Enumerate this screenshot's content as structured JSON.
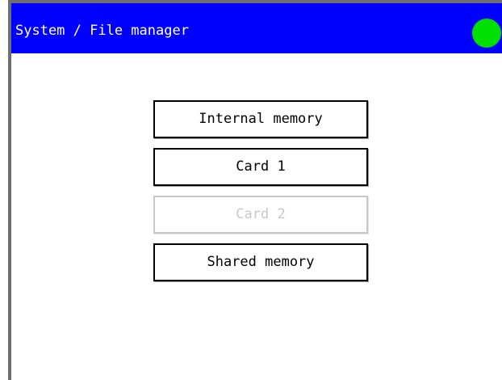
{
  "header": {
    "title": "System / File manager",
    "status_indicator": {
      "color": "#00e000",
      "icon": "status-indicator-dot"
    },
    "background_color": "#0000ff",
    "text_color": "#ffffff"
  },
  "menu": {
    "items": [
      {
        "label": "Internal memory",
        "enabled": true
      },
      {
        "label": "Card 1",
        "enabled": true
      },
      {
        "label": "Card 2",
        "enabled": false
      },
      {
        "label": "Shared memory",
        "enabled": true
      }
    ]
  }
}
